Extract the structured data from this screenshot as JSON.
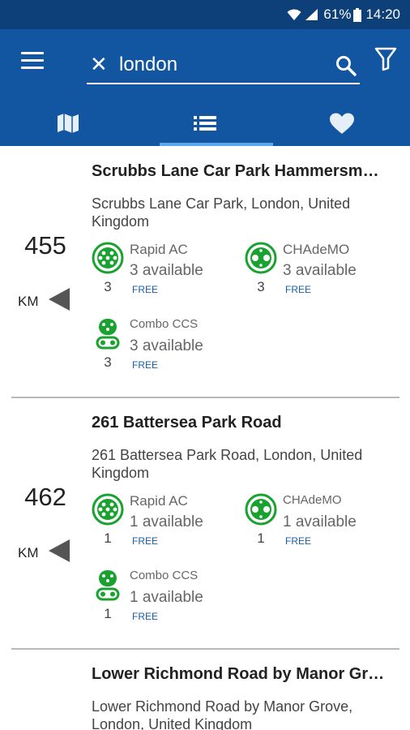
{
  "status": {
    "battery": "61%",
    "time": "14:20"
  },
  "search": {
    "query": "london"
  },
  "tabs": [
    {
      "icon": "map-icon"
    },
    {
      "icon": "list-icon",
      "active": true
    },
    {
      "icon": "heart-icon"
    }
  ],
  "colors": {
    "statusbar": "#0d3f78",
    "appbar": "#1255a0",
    "tab_indicator": "#5aa7ef",
    "connector_green": "#19a22f",
    "free_text": "#1a5ea8"
  },
  "results": [
    {
      "distance": "455",
      "unit": "KM",
      "title": "Scrubbs Lane Car Park Hammersm…",
      "address": "Scrubbs Lane Car Park, London, United Kingdom",
      "connectors": [
        {
          "name": "Rapid AC",
          "availability": "3 available",
          "count": "3",
          "price": "FREE",
          "icon": "type2-connector-icon"
        },
        {
          "name": "CHAdeMO",
          "availability": "3 available",
          "count": "3",
          "price": "FREE",
          "icon": "chademo-connector-icon"
        },
        {
          "name": "Combo CCS",
          "availability": "3 available",
          "count": "3",
          "price": "FREE",
          "icon": "ccs-connector-icon"
        }
      ]
    },
    {
      "distance": "462",
      "unit": "KM",
      "title": "261 Battersea Park Road",
      "address": "261 Battersea Park Road, London, United Kingdom",
      "connectors": [
        {
          "name": "Rapid AC",
          "availability": "1 available",
          "count": "1",
          "price": "FREE",
          "icon": "type2-connector-icon"
        },
        {
          "name": "CHAdeMO",
          "availability": "1 available",
          "count": "1",
          "price": "FREE",
          "icon": "chademo-connector-icon"
        },
        {
          "name": "Combo CCS",
          "availability": "1 available",
          "count": "1",
          "price": "FREE",
          "icon": "ccs-connector-icon"
        }
      ]
    },
    {
      "title": "Lower Richmond Road by Manor Gr…",
      "address": "Lower Richmond Road by Manor Grove, London, United Kingdom"
    }
  ]
}
